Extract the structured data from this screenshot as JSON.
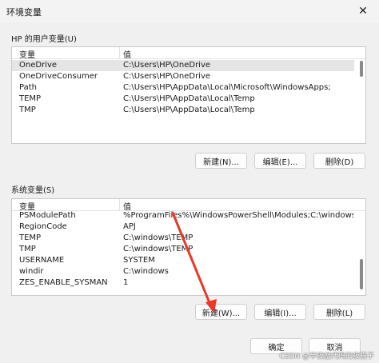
{
  "window": {
    "title": "环境变量",
    "close_glyph": "✕"
  },
  "user_vars": {
    "group_label": "HP 的用户变量(U)",
    "columns": {
      "name": "变量",
      "value": "值"
    },
    "rows": [
      {
        "name": "OneDrive",
        "value": "C:\\Users\\HP\\OneDrive"
      },
      {
        "name": "OneDriveConsumer",
        "value": "C:\\Users\\HP\\OneDrive"
      },
      {
        "name": "Path",
        "value": "C:\\Users\\HP\\AppData\\Local\\Microsoft\\WindowsApps;"
      },
      {
        "name": "TEMP",
        "value": "C:\\Users\\HP\\AppData\\Local\\Temp"
      },
      {
        "name": "TMP",
        "value": "C:\\Users\\HP\\AppData\\Local\\Temp"
      }
    ],
    "buttons": {
      "new": "新建(N)...",
      "edit": "编辑(E)...",
      "delete": "删除(D)"
    }
  },
  "system_vars": {
    "group_label": "系统变量(S)",
    "columns": {
      "name": "变量",
      "value": "值"
    },
    "rows": [
      {
        "name": "PSModulePath",
        "value": "%ProgramFiles%\\WindowsPowerShell\\Modules;C:\\windows\\syste..."
      },
      {
        "name": "RegionCode",
        "value": "APJ"
      },
      {
        "name": "TEMP",
        "value": "C:\\windows\\TEMP"
      },
      {
        "name": "TMP",
        "value": "C:\\windows\\TEMP"
      },
      {
        "name": "USERNAME",
        "value": "SYSTEM"
      },
      {
        "name": "windir",
        "value": "C:\\windows"
      },
      {
        "name": "ZES_ENABLE_SYSMAN",
        "value": "1"
      }
    ],
    "buttons": {
      "new": "新建(W)...",
      "edit": "编辑(I)...",
      "delete": "删除(L)"
    }
  },
  "footer": {
    "ok": "确定",
    "cancel": "取消"
  },
  "watermark": "CSDN @半夜敲代码的夜猫子",
  "colors": {
    "annotation_arrow": "#e8392b",
    "selected_row": "#e5e5e5"
  }
}
